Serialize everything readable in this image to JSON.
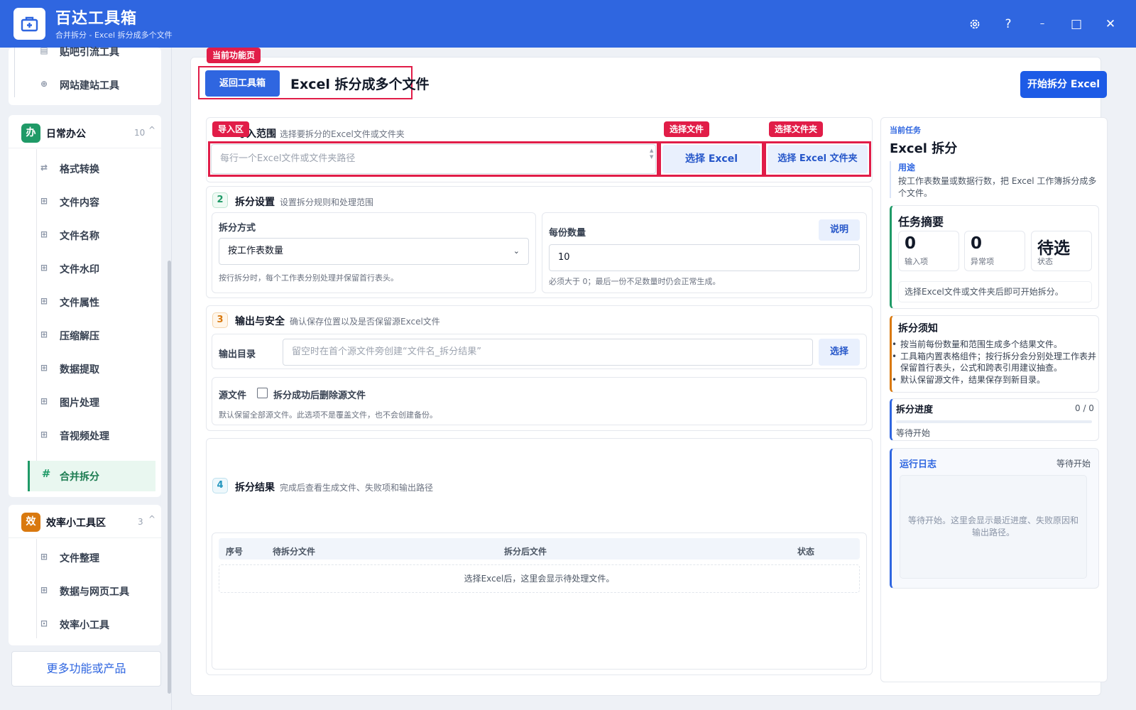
{
  "app": {
    "title": "百达工具箱",
    "subtitle": "合并拆分 - Excel 拆分成多个文件"
  },
  "window_controls": {
    "settings_icon": "gear-icon",
    "help_label": "?",
    "minimize_label": "–",
    "maximize_label": "□",
    "close_label": "✕"
  },
  "sidebar": {
    "top_items": [
      {
        "label": "贴吧引流工具",
        "icon": "list-icon"
      },
      {
        "label": "网站建站工具",
        "icon": "globe-icon"
      }
    ],
    "groups": [
      {
        "badge": "办",
        "badge_color": "#1f9a67",
        "title": "日常办公",
        "count": "10",
        "chevron": "^",
        "items": [
          {
            "label": "格式转换",
            "icon": "swap-icon",
            "glyph": "⇄"
          },
          {
            "label": "文件内容",
            "icon": "grid-icon",
            "glyph": "⊞"
          },
          {
            "label": "文件名称",
            "icon": "grid-icon",
            "glyph": "⊞"
          },
          {
            "label": "文件水印",
            "icon": "grid-icon",
            "glyph": "⊞"
          },
          {
            "label": "文件属性",
            "icon": "grid-icon",
            "glyph": "⊞"
          },
          {
            "label": "压缩解压",
            "icon": "grid-icon",
            "glyph": "⊞"
          },
          {
            "label": "数据提取",
            "icon": "grid-icon",
            "glyph": "⊞"
          },
          {
            "label": "图片处理",
            "icon": "grid-icon",
            "glyph": "⊞"
          },
          {
            "label": "音视频处理",
            "icon": "grid-icon",
            "glyph": "⊞"
          },
          {
            "label": "合并拆分",
            "icon": "hash-icon",
            "glyph": "#",
            "active": true
          }
        ]
      },
      {
        "badge": "效",
        "badge_color": "#d9790f",
        "title": "效率小工具区",
        "count": "3",
        "chevron": "^",
        "items": [
          {
            "label": "文件整理",
            "icon": "grid-icon",
            "glyph": "⊞"
          },
          {
            "label": "数据与网页工具",
            "icon": "grid-icon",
            "glyph": "⊞"
          },
          {
            "label": "效率小工具",
            "icon": "toolbox-icon",
            "glyph": "⊡"
          }
        ]
      }
    ],
    "more_label": "更多功能或产品"
  },
  "header": {
    "tag": "当前功能页",
    "back_label": "返回工具箱",
    "title": "Excel 拆分成多个文件",
    "start_label": "开始拆分 Excel"
  },
  "import": {
    "tag": "导入区",
    "step": "1",
    "title": "导入范围",
    "desc": "选择要拆分的Excel文件或文件夹",
    "placeholder": "每行一个Excel文件或文件夹路径",
    "file_tag": "选择文件",
    "file_btn": "选择 Excel",
    "folder_tag": "选择文件夹",
    "folder_btn": "选择 Excel 文件夹"
  },
  "settings": {
    "step": "2",
    "title": "拆分设置",
    "desc": "设置拆分规则和处理范围",
    "mode_label": "拆分方式",
    "mode_value": "按工作表数量",
    "mode_hint": "按行拆分时，每个工作表分别处理并保留首行表头。",
    "count_label": "每份数量",
    "count_value": "10",
    "count_help": "说明",
    "count_hint": "必须大于 0；最后一份不足数量时仍会正常生成。"
  },
  "output": {
    "step": "3",
    "title": "输出与安全",
    "desc": "确认保存位置以及是否保留源Excel文件",
    "dir_label": "输出目录",
    "dir_placeholder": "留空时在首个源文件旁创建“文件名_拆分结果”",
    "dir_btn": "选择",
    "src_label": "源文件",
    "delete_label": "拆分成功后删除源文件",
    "delete_checked": false,
    "src_hint": "默认保留全部源文件。此选项不是覆盖文件，也不会创建备份。"
  },
  "result": {
    "step": "4",
    "title": "拆分结果",
    "desc": "完成后查看生成文件、失败项和输出路径",
    "columns": [
      "序号",
      "待拆分文件",
      "拆分后文件",
      "状态"
    ],
    "empty": "选择Excel后，这里会显示待处理文件。"
  },
  "task": {
    "label": "当前任务",
    "name": "Excel 拆分",
    "purpose_label": "用途",
    "purpose": "按工作表数量或数据行数，把 Excel 工作簿拆分成多个文件。"
  },
  "summary": {
    "title": "任务摘要",
    "stats": [
      {
        "value": "0",
        "label": "输入项"
      },
      {
        "value": "0",
        "label": "异常项"
      },
      {
        "value": "待选",
        "label": "状态"
      }
    ],
    "hint": "选择Excel文件或文件夹后即可开始拆分。"
  },
  "notes": {
    "title": "拆分须知",
    "items": [
      "按当前每份数量和范围生成多个结果文件。",
      "工具箱内置表格组件；按行拆分会分别处理工作表并保留首行表头，公式和跨表引用建议抽查。",
      "默认保留源文件，结果保存到新目录。"
    ]
  },
  "progress": {
    "title": "拆分进度",
    "count": "0 / 0",
    "value": 0,
    "status": "等待开始"
  },
  "log": {
    "title": "运行日志",
    "status": "等待开始",
    "placeholder": "等待开始。这里会显示最近进度、失败原因和输出路径。"
  },
  "colors": {
    "primary": "#2f66e0",
    "highlight": "#e11d48",
    "active_green": "#1f9a67",
    "warning": "#d9790f"
  }
}
